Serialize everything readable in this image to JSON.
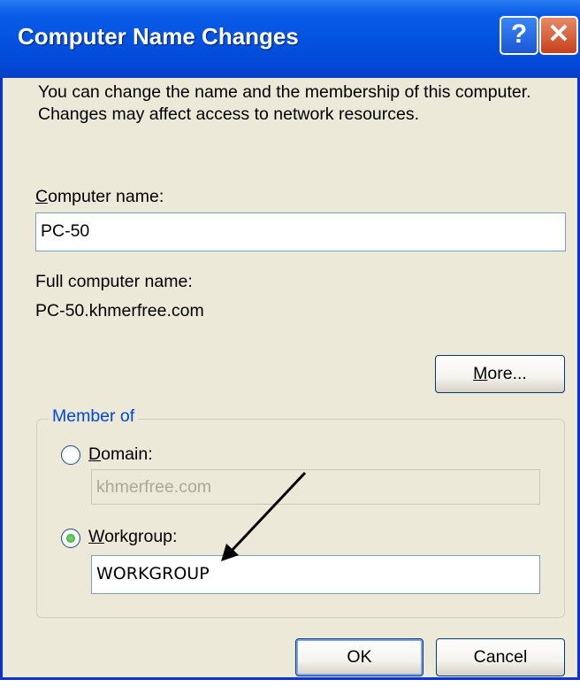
{
  "dialog": {
    "title": "Computer Name Changes",
    "help_glyph": "?",
    "close_glyph": "✕"
  },
  "description": "You can change the name and the membership of this computer. Changes may affect access to network resources.",
  "computer_name": {
    "label_mnemonic": "C",
    "label_rest": "omputer name:",
    "value": "PC-50"
  },
  "full_computer_name": {
    "label": "Full computer name:",
    "value": "PC-50.khmerfree.com"
  },
  "more_button": {
    "mnemonic": "M",
    "rest": "ore..."
  },
  "member_of": {
    "legend": "Member of",
    "domain": {
      "mnemonic": "D",
      "rest": "omain:",
      "value": "khmerfree.com",
      "selected": false
    },
    "workgroup": {
      "mnemonic": "W",
      "rest": "orkgroup:",
      "value": "WORKGROUP",
      "selected": true
    }
  },
  "buttons": {
    "ok": "OK",
    "cancel": "Cancel"
  },
  "colors": {
    "titlebar": "#0353E0",
    "face": "#ECE9D8",
    "legend": "#0046D5",
    "annotation_arrow": "#000000"
  }
}
